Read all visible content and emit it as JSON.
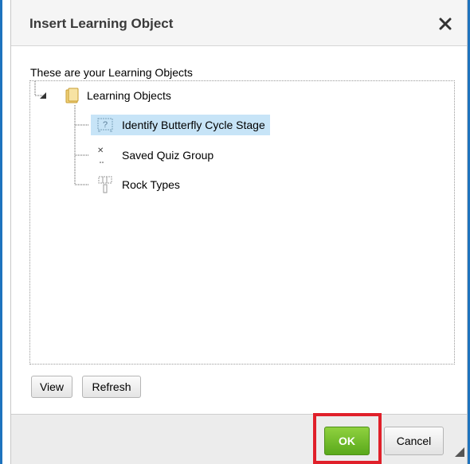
{
  "dialog": {
    "title": "Insert Learning Object",
    "close_icon": "close-icon"
  },
  "tree": {
    "heading": "These are your Learning Objects",
    "root": {
      "label": "Learning Objects",
      "icon": "folder-icon",
      "expanded": true
    },
    "items": [
      {
        "label": "Identify Butterfly Cycle Stage",
        "icon": "question-icon",
        "selected": true
      },
      {
        "label": "Saved Quiz Group",
        "icon": "quiz-group-icon",
        "selected": false
      },
      {
        "label": "Rock Types",
        "icon": "table-icon",
        "selected": false
      }
    ]
  },
  "buttons": {
    "view": "View",
    "refresh": "Refresh",
    "ok": "OK",
    "cancel": "Cancel"
  },
  "colors": {
    "selection": "#c7e4f7",
    "ok_green": "#6cb92b",
    "highlight_red": "#e0202a",
    "frame_blue": "#1e73be"
  }
}
